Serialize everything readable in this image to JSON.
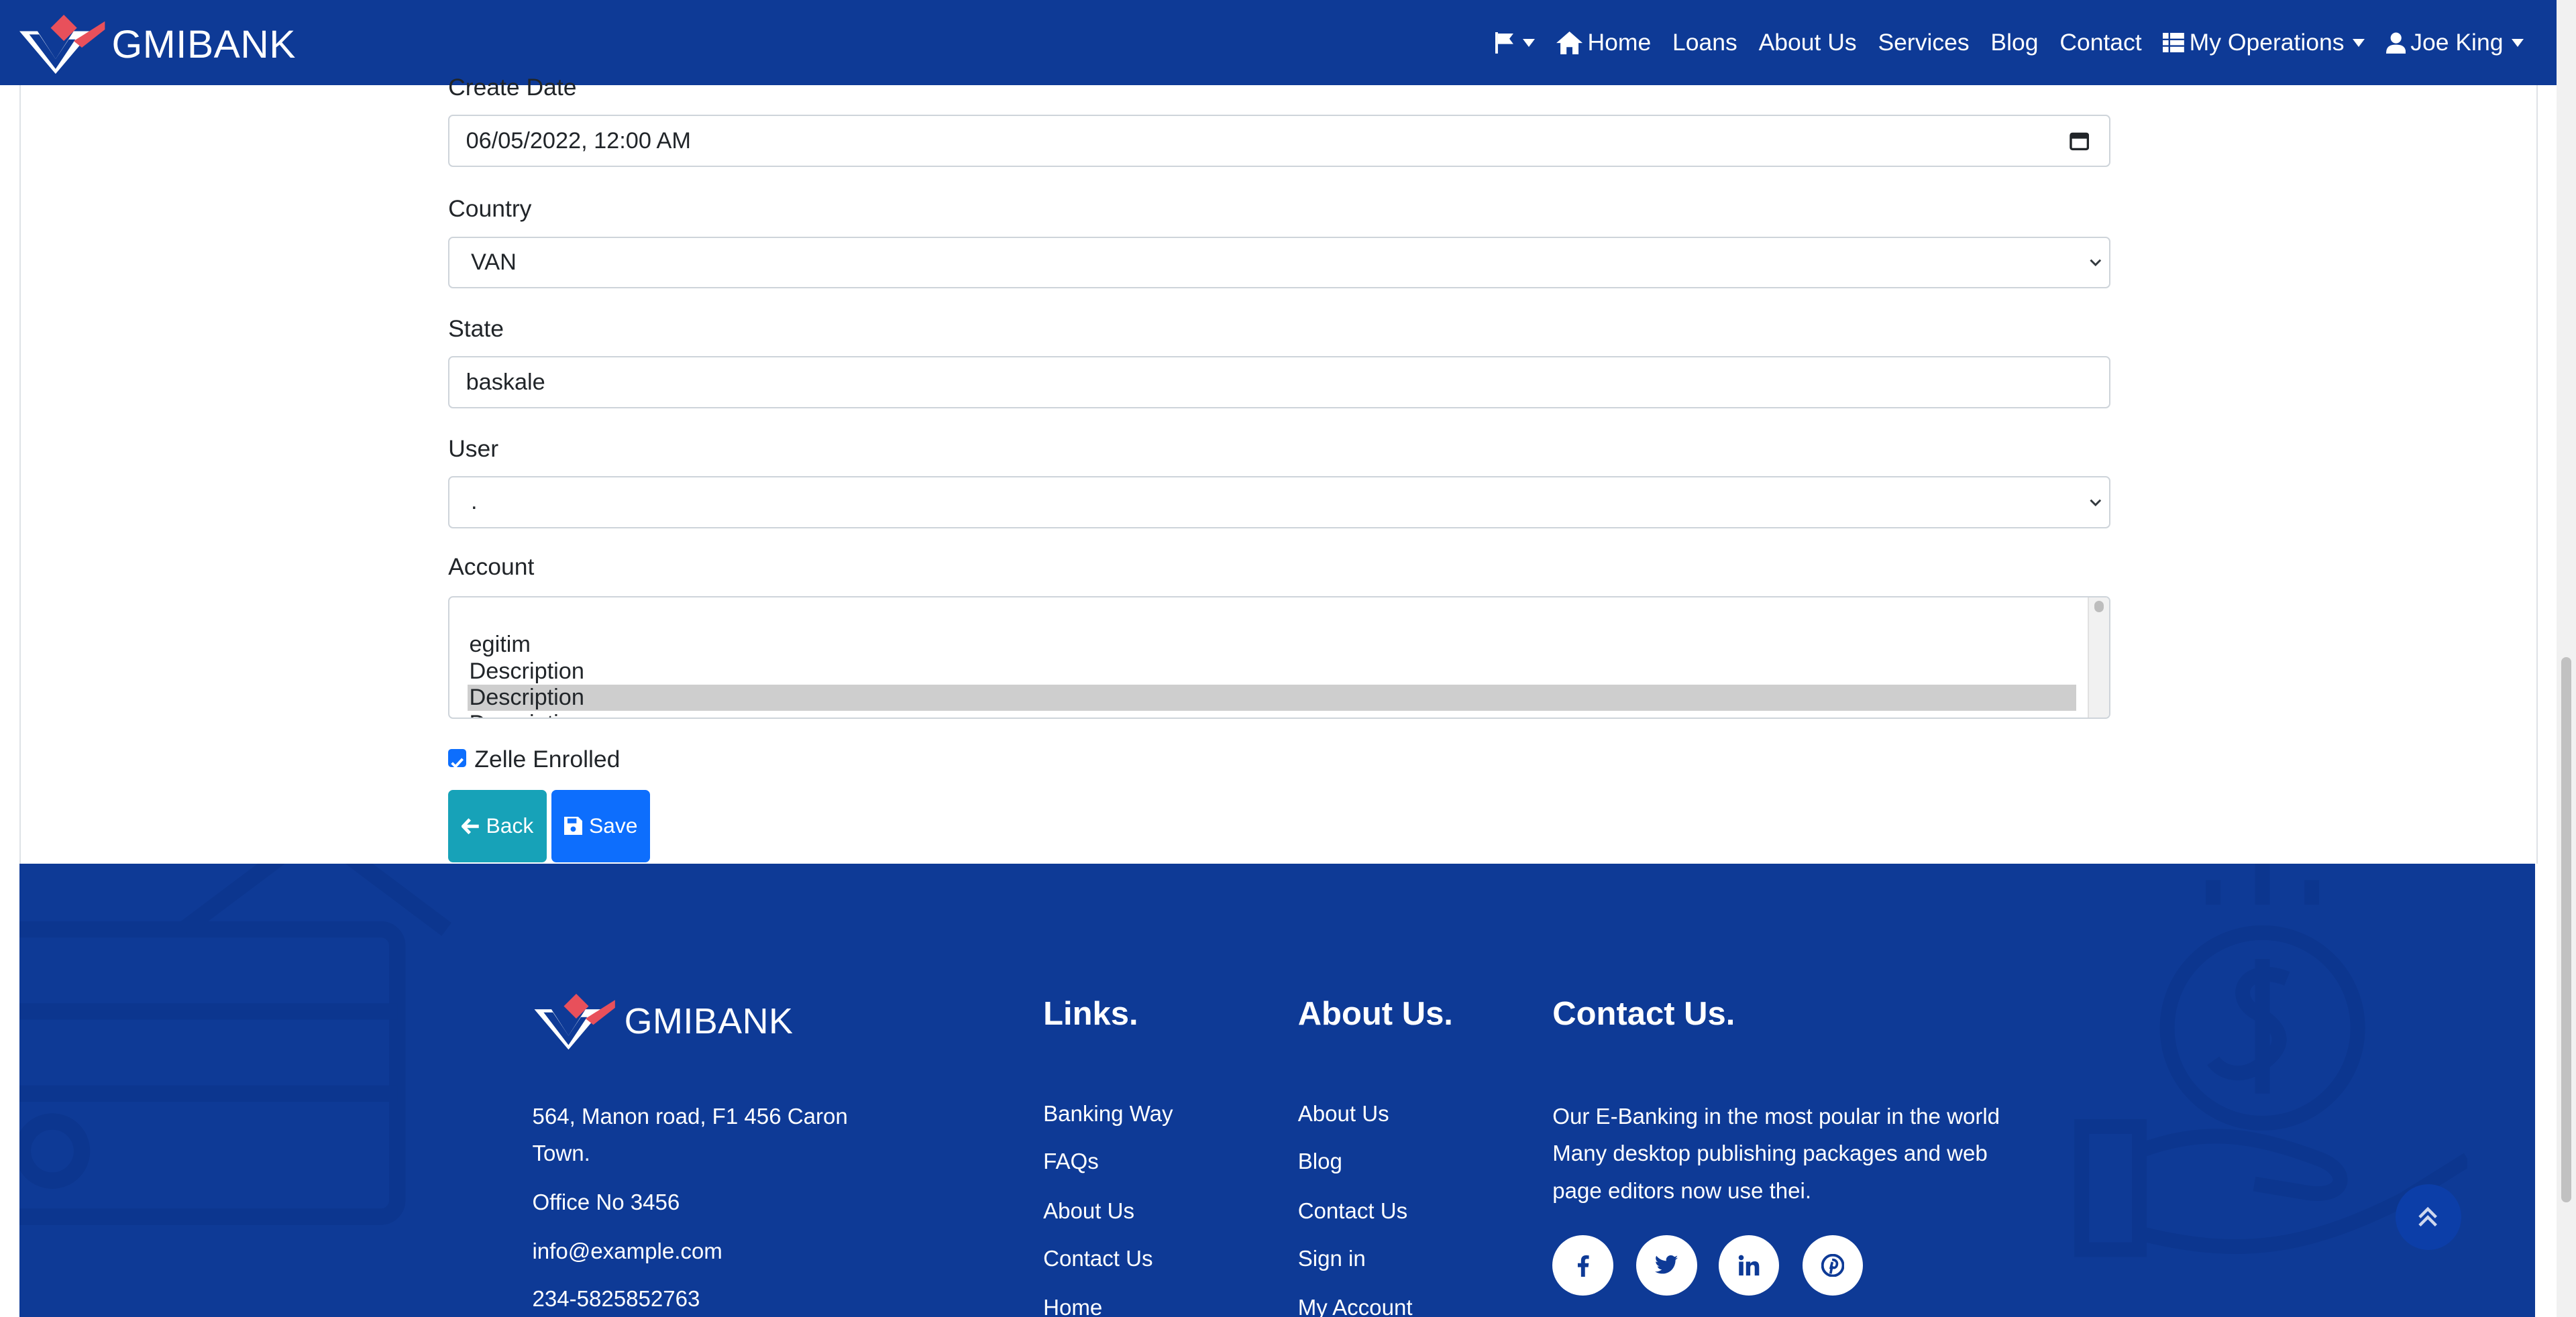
{
  "navbar": {
    "brand": "GMIBANK",
    "items": [
      {
        "label": "",
        "icon": "flag-icon"
      },
      {
        "label": "Home",
        "icon": "home-icon"
      },
      {
        "label": "Loans"
      },
      {
        "label": "About Us"
      },
      {
        "label": "Services"
      },
      {
        "label": "Blog"
      },
      {
        "label": "Contact"
      },
      {
        "label": "My Operations",
        "icon": "table-icon"
      },
      {
        "label": "Joe King",
        "icon": "user-icon"
      }
    ]
  },
  "form": {
    "create_date": {
      "label": "Create Date",
      "value": "06/05/2022, 12:00 AM"
    },
    "country": {
      "label": "Country",
      "value": "VAN"
    },
    "state": {
      "label": "State",
      "value": "baskale"
    },
    "user": {
      "label": "User",
      "value": "."
    },
    "account": {
      "label": "Account",
      "options": [
        "",
        "egitim",
        "Description",
        "Description",
        "Description"
      ],
      "selected_index": 3
    },
    "zelle": {
      "label": "Zelle Enrolled",
      "checked": true
    },
    "back_label": "Back",
    "save_label": "Save"
  },
  "footer": {
    "brand": "GMIBANK",
    "address": "564, Manon road, F1 456 Caron Town.",
    "office": "Office No 3456",
    "email": "info@example.com",
    "phone": "234-5825852763",
    "links_heading": "Links.",
    "links": [
      "Banking Way",
      "FAQs",
      "About Us",
      "Contact Us",
      "Home"
    ],
    "about_heading": "About Us.",
    "about_links": [
      "About Us",
      "Blog",
      "Contact Us",
      "Sign in",
      "My Account"
    ],
    "contact_heading": "Contact Us.",
    "contact_text": "Our E-Banking in the most poular in the world Many desktop publishing packages and web page editors now use thei.",
    "social": [
      "facebook-icon",
      "twitter-icon",
      "linkedin-icon",
      "pinterest-icon"
    ]
  },
  "colors": {
    "navy": "#0e3a96",
    "back_button": "#17a2b8",
    "save_button": "#0d6efd",
    "logo_red": "#e8505b"
  }
}
